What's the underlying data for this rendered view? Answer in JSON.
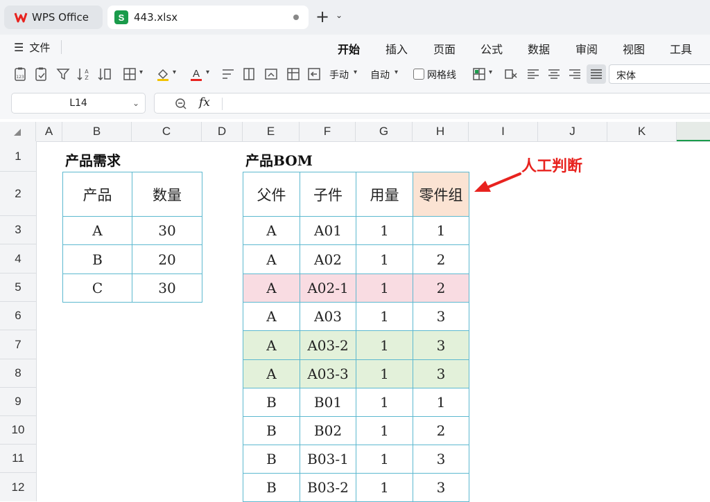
{
  "app": {
    "tabs": [
      {
        "label": "WPS Office"
      },
      {
        "label": "443.xlsx",
        "icon_letter": "S"
      }
    ],
    "new_tab": "+"
  },
  "menu": {
    "file_label": "文件",
    "tabs": [
      "开始",
      "插入",
      "页面",
      "公式",
      "数据",
      "审阅",
      "视图",
      "工具"
    ],
    "active_tab": "开始"
  },
  "toolbar": {
    "wrap_manual": "手动",
    "wrap_auto": "自动",
    "gridlines_label": "网格线",
    "gridlines_checked": false,
    "font_name": "宋体"
  },
  "formula_bar": {
    "cell_ref": "L14",
    "fx_label": "fx",
    "content": ""
  },
  "grid": {
    "columns": [
      "A",
      "B",
      "C",
      "D",
      "E",
      "F",
      "G",
      "H",
      "I",
      "J",
      "K"
    ],
    "rows": [
      "1",
      "2",
      "3",
      "4",
      "5",
      "6",
      "7",
      "8",
      "9",
      "10",
      "11",
      "12"
    ]
  },
  "demand": {
    "title": "产品需求",
    "headers": [
      "产品",
      "数量"
    ],
    "rows": [
      [
        "A",
        "30"
      ],
      [
        "B",
        "20"
      ],
      [
        "C",
        "30"
      ]
    ]
  },
  "bom": {
    "title": "产品BOM",
    "headers": [
      "父件",
      "子件",
      "用量",
      "零件组"
    ],
    "rows": [
      [
        "A",
        "A01",
        "1",
        "1"
      ],
      [
        "A",
        "A02",
        "1",
        "2"
      ],
      [
        "A",
        "A02-1",
        "1",
        "2"
      ],
      [
        "A",
        "A03",
        "1",
        "3"
      ],
      [
        "A",
        "A03-2",
        "1",
        "3"
      ],
      [
        "A",
        "A03-3",
        "1",
        "3"
      ],
      [
        "B",
        "B01",
        "1",
        "1"
      ],
      [
        "B",
        "B02",
        "1",
        "2"
      ],
      [
        "B",
        "B03-1",
        "1",
        "3"
      ],
      [
        "B",
        "B03-2",
        "1",
        "3"
      ]
    ]
  },
  "annotation": {
    "text": "人工判断",
    "color": "#e8231f"
  },
  "colors": {
    "accent": "#1a9b4b",
    "table_border": "#5cb8cf",
    "highlight_pink": "#f9dce2",
    "highlight_green": "#e3f1da",
    "highlight_orange": "#fbe3d3"
  }
}
